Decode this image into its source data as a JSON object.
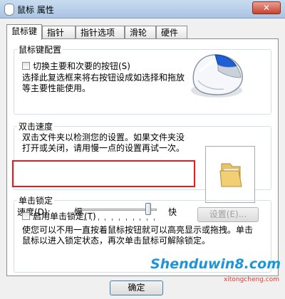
{
  "window": {
    "title": "鼠标 属性",
    "close_glyph": "✕"
  },
  "tabs": [
    {
      "label": "鼠标键",
      "active": true
    },
    {
      "label": "指针"
    },
    {
      "label": "指针选项"
    },
    {
      "label": "滑轮"
    },
    {
      "label": "硬件"
    }
  ],
  "button_config": {
    "legend": "鼠标键配置",
    "switch_label": "切换主要和次要的按钮(S)",
    "switch_checked": false,
    "desc_line1": "选择此复选框来将右按钮设成如选择和拖放",
    "desc_line2": "等主要性能使用。"
  },
  "double_click": {
    "legend": "双击速度",
    "desc_line1": "双击文件夹以检测您的设置。如果文件夹没",
    "desc_line2": "打开或关闭，请用慢一点的设置再试一次。",
    "speed_label": "速度(D):",
    "slow_label": "慢",
    "fast_label": "快",
    "speed_level": 0.92
  },
  "click_lock": {
    "legend": "单击锁定",
    "enable_label": "启用单击锁定(T)",
    "enable_checked": false,
    "settings_label": "设置(E)...",
    "desc_line1": "使您可以不用一直按着鼠标按钮就可以高亮显示或拖拽。单击",
    "desc_line2": "鼠标以进入锁定状态，再次单击鼠标可解除锁定。"
  },
  "footer": {
    "ok_label": "确定"
  },
  "watermark": {
    "text": "Shenduwin8.com",
    "sub": "xitongcheng.com"
  },
  "colors": {
    "highlight": "#e02020",
    "titlebar": "#b9d1ea",
    "watermark": "#1f95d9"
  }
}
